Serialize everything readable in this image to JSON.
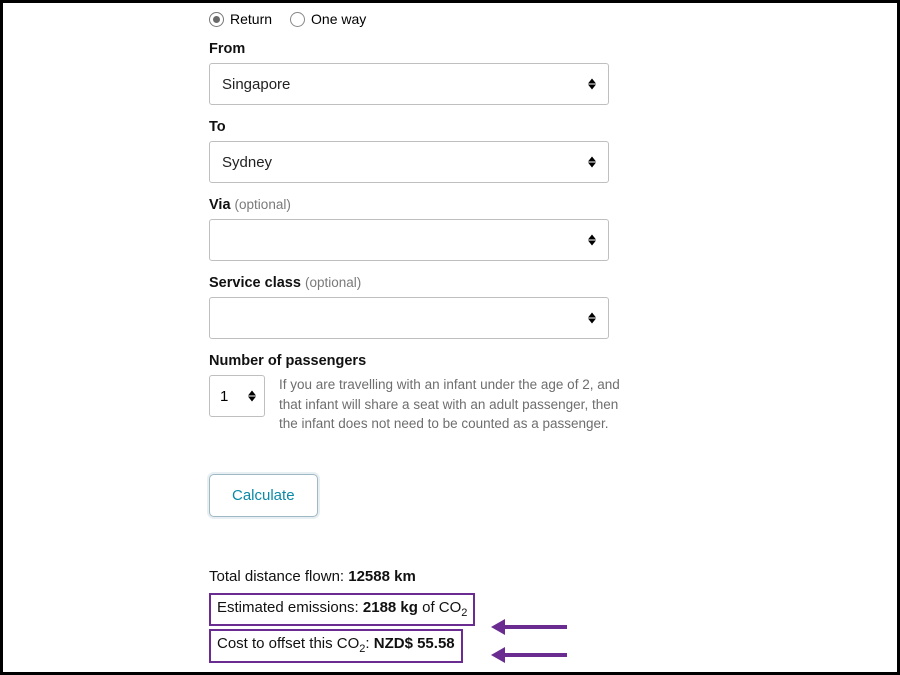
{
  "trip_type": {
    "return_label": "Return",
    "oneway_label": "One way",
    "selected": "return"
  },
  "from": {
    "label": "From",
    "value": "Singapore"
  },
  "to": {
    "label": "To",
    "value": "Sydney"
  },
  "via": {
    "label": "Via",
    "optional_label": "(optional)",
    "value": ""
  },
  "service_class": {
    "label": "Service class",
    "optional_label": "(optional)",
    "value": ""
  },
  "passengers": {
    "label": "Number of passengers",
    "value": "1",
    "note": "If you are travelling with an infant under the age of 2, and that infant will share a seat with an adult passenger, then the infant does not need to be counted as a passenger."
  },
  "calculate_label": "Calculate",
  "results": {
    "distance_prefix": "Total distance flown: ",
    "distance_value": "12588 km",
    "emissions_prefix": "Estimated emissions: ",
    "emissions_value": "2188 kg",
    "emissions_suffix_pre": " of CO",
    "emissions_sub": "2",
    "cost_prefix_pre": "Cost to offset this CO",
    "cost_sub": "2",
    "cost_prefix_post": ": ",
    "cost_value": "NZD$ 55.58"
  }
}
